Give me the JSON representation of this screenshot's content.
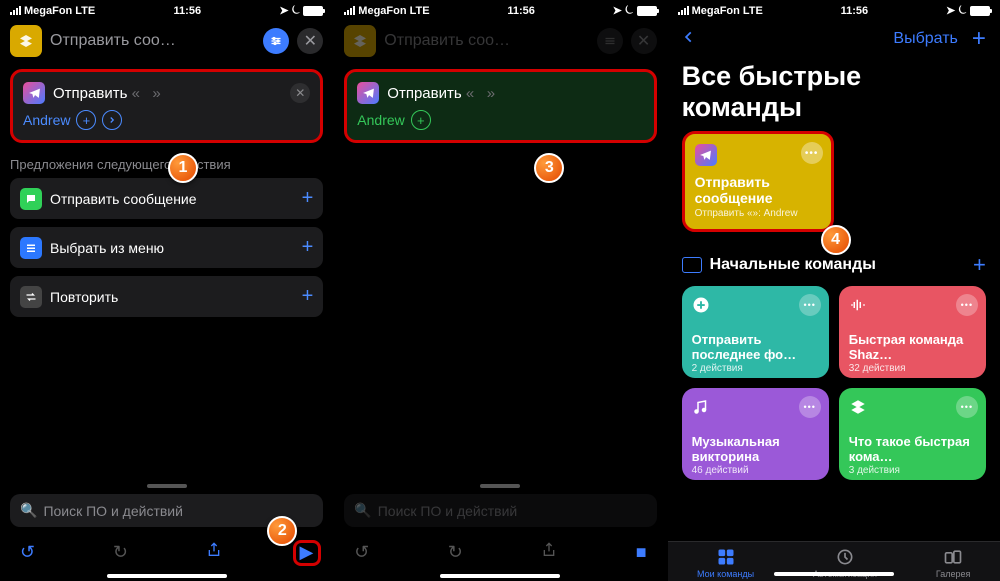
{
  "status": {
    "carrier": "MegaFon",
    "net": "LTE",
    "time": "11:56"
  },
  "panel1": {
    "title": "Отправить соо…",
    "card": {
      "verb": "Отправить",
      "q1": "«",
      "q2": "»",
      "name": "Andrew"
    },
    "suggest_h": "Предложения следующего действия",
    "s1": "Отправить сообщение",
    "s2": "Выбрать из меню",
    "s3": "Повторить",
    "search": "Поиск ПО и действий"
  },
  "panel2": {
    "card": {
      "verb": "Отправить",
      "q1": "«",
      "q2": "»",
      "name": "Andrew"
    }
  },
  "panel3": {
    "select": "Выбрать",
    "title": "Все быстрые команды",
    "tile": {
      "name": "Отправить сообщение",
      "sub": "Отправить «»: Andrew"
    },
    "starter": "Начальные команды",
    "g": [
      {
        "name": "Отправить последнее фо…",
        "sub": "2 действия"
      },
      {
        "name": "Быстрая команда Shaz…",
        "sub": "32 действия"
      },
      {
        "name": "Музыкальная викторина",
        "sub": "46 действий"
      },
      {
        "name": "Что такое быстрая кома…",
        "sub": "3 действия"
      }
    ],
    "tabs": {
      "a": "Мои команды",
      "b": "Автоматизация",
      "c": "Галерея"
    }
  }
}
